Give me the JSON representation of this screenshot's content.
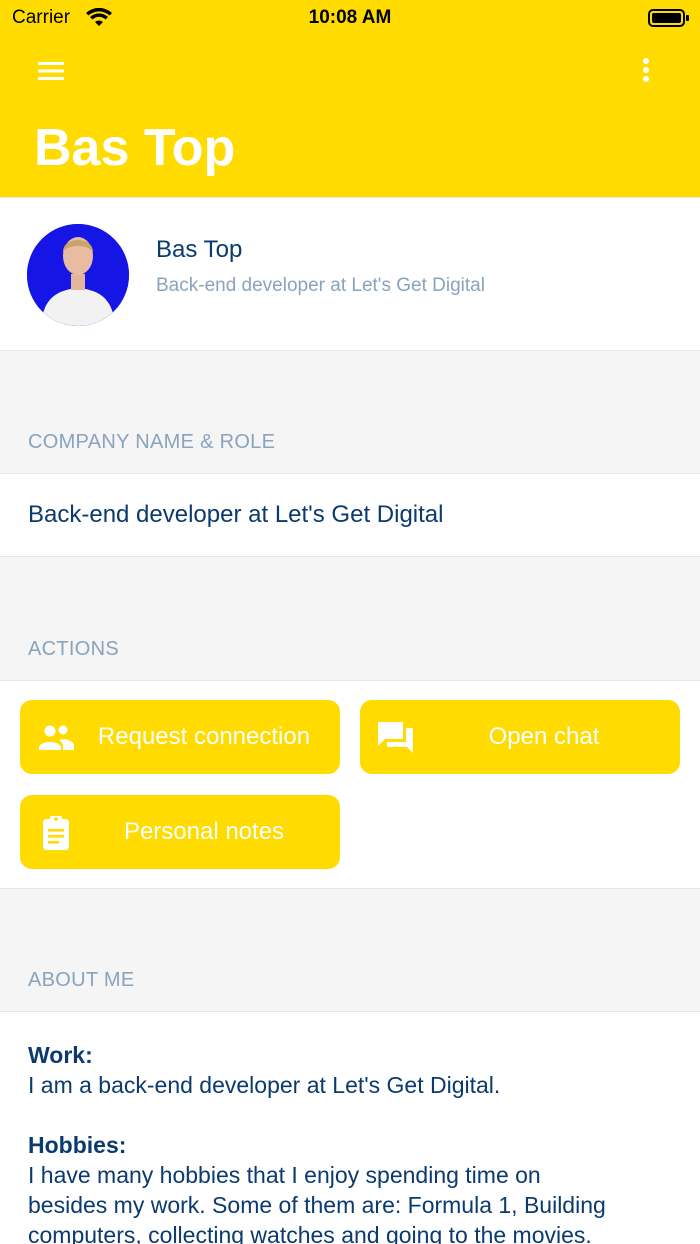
{
  "status_bar": {
    "carrier": "Carrier",
    "time": "10:08 AM"
  },
  "header": {
    "title": "Bas Top",
    "menu_icon": "hamburger-menu-icon",
    "more_icon": "more-vertical-icon",
    "color": "#ffdb00"
  },
  "profile": {
    "name": "Bas Top",
    "role": "Back-end developer at Let's Get Digital",
    "avatar_bg": "#1515e6"
  },
  "company_section": {
    "label": "COMPANY NAME & ROLE",
    "value": "Back-end developer at Let's Get Digital"
  },
  "actions_section": {
    "label": "ACTIONS",
    "buttons": [
      {
        "label": "Request connection",
        "icon": "people-icon"
      },
      {
        "label": "Open chat",
        "icon": "chat-icon"
      },
      {
        "label": "Personal notes",
        "icon": "clipboard-icon"
      }
    ]
  },
  "about_section": {
    "label": "ABOUT ME",
    "work_heading": "Work:",
    "work_text": "I am a back-end developer at Let's Get Digital.",
    "hobbies_heading": "Hobbies:",
    "hobbies_text_1": "I have many hobbies that I enjoy spending time on",
    "hobbies_text_2": "besides my work. Some of them are: Formula 1, Building",
    "hobbies_text_3": "computers, collecting watches and going to the movies."
  },
  "colors": {
    "accent": "#ffdb00",
    "primary_text": "#0b3a6e",
    "secondary_text": "#8aa3bd",
    "background": "#f5f5f5"
  }
}
